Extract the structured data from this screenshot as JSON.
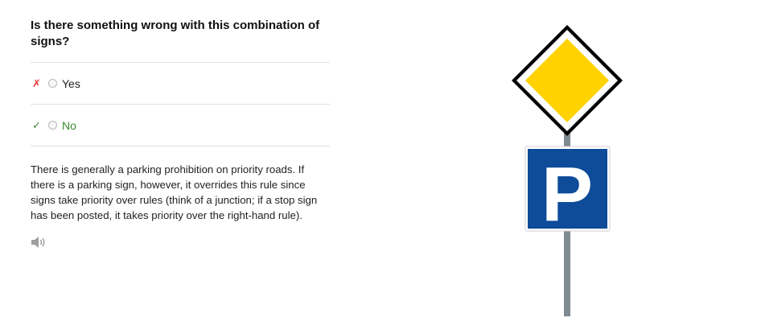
{
  "question": {
    "title": "Is there something wrong with this combination of signs?"
  },
  "answers": [
    {
      "mark": "✗",
      "label": "Yes",
      "status": "wrong"
    },
    {
      "mark": "✓",
      "label": "No",
      "status": "correct"
    }
  ],
  "explanation": "There is generally a parking prohibition on priority roads. If there is a parking sign, however, it overrides this rule since signs take priority over rules (think of a junction; if a stop sign has been posted, it takes priority over the right-hand rule).",
  "audio": {
    "icon": "speaker-icon"
  },
  "illustration": {
    "parking_letter": "P",
    "colors": {
      "priority_yellow": "#FFD200",
      "parking_blue": "#0E4C9A",
      "pole_gray": "#7F8A91",
      "correct_green": "#3a8a2e",
      "wrong_red": "#e53935"
    }
  }
}
